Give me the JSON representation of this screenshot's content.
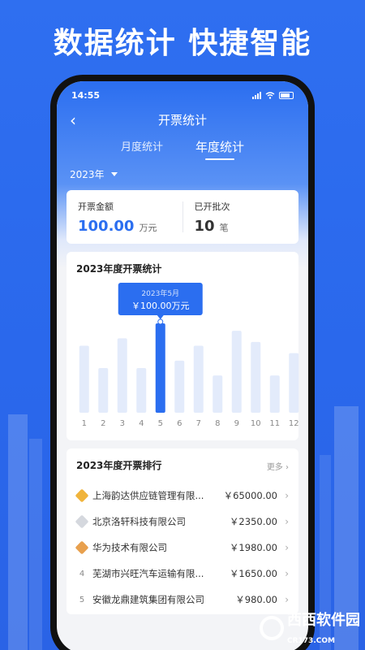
{
  "headline": "数据统计 快捷智能",
  "status": {
    "time": "14:55"
  },
  "nav": {
    "title": "开票统计"
  },
  "tabs": [
    {
      "label": "月度统计",
      "active": false
    },
    {
      "label": "年度统计",
      "active": true
    }
  ],
  "year_select": {
    "value": "2023年"
  },
  "summary": {
    "amount_label": "开票金额",
    "amount_value": "100.00",
    "amount_unit": "万元",
    "batches_label": "已开批次",
    "batches_value": "10",
    "batches_unit": "笔"
  },
  "chart_data": {
    "type": "bar",
    "title": "2023年度开票统计",
    "categories": [
      "1",
      "2",
      "3",
      "4",
      "5",
      "6",
      "7",
      "8",
      "9",
      "10",
      "11",
      "12"
    ],
    "values": [
      90,
      60,
      100,
      60,
      120,
      70,
      90,
      50,
      110,
      95,
      50,
      80
    ],
    "highlight_index": 4,
    "tooltip": {
      "line1": "2023年5月",
      "line2": "￥100.00万元"
    },
    "colors": {
      "bar": "#e3ebfb",
      "highlight": "#2b6ef0"
    }
  },
  "ranking": {
    "title": "2023年度开票排行",
    "more_label": "更多",
    "rows": [
      {
        "rank": "",
        "medal": "#f0b43c",
        "name": "上海韵达供应链管理有限...",
        "amount": "￥65000.00"
      },
      {
        "rank": "",
        "medal": "#d5d8de",
        "name": "北京洛轩科技有限公司",
        "amount": "￥2350.00"
      },
      {
        "rank": "",
        "medal": "#e8a04e",
        "name": "华为技术有限公司",
        "amount": "￥1980.00"
      },
      {
        "rank": "4",
        "medal": "",
        "name": "芜湖市兴旺汽车运输有限...",
        "amount": "￥1650.00"
      },
      {
        "rank": "5",
        "medal": "",
        "name": "安徽龙鼎建筑集团有限公司",
        "amount": "￥980.00"
      }
    ]
  },
  "watermark": {
    "brand": "西西软件园",
    "site": "CR173.COM"
  }
}
